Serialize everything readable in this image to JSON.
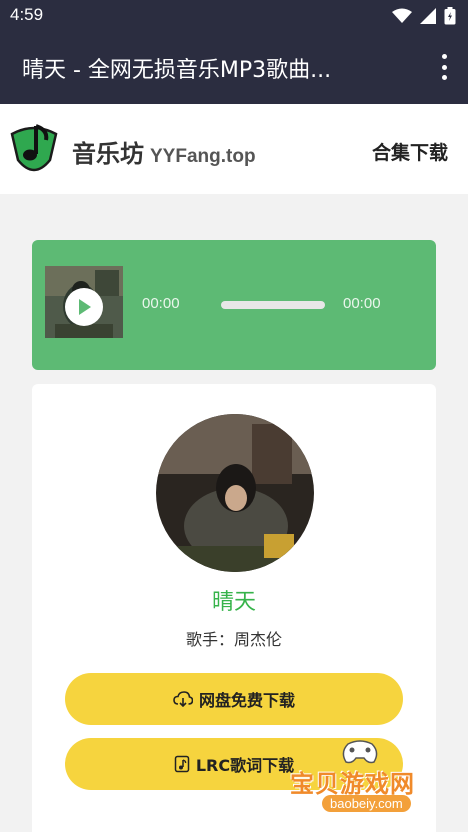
{
  "status_bar": {
    "time": "4:59"
  },
  "app_bar": {
    "title": "晴天 - 全网无损音乐MP3歌曲..."
  },
  "site_header": {
    "brand_name": "音乐坊",
    "brand_domain": "YYFang.top",
    "collection_download": "合集下载"
  },
  "player": {
    "current_time": "00:00",
    "duration": "00:00",
    "progress": 0
  },
  "song": {
    "title": "晴天",
    "artist_line": "歌手：周杰伦"
  },
  "buttons": {
    "netdisk_download": "网盘免费下载",
    "lrc_download": "LRC歌词下载"
  },
  "watermark": {
    "text": "宝贝游戏网",
    "url": "baobeiy.com"
  },
  "colors": {
    "bar_bg": "#2b2d40",
    "player_green": "#5dba74",
    "title_green": "#36b34a",
    "button_yellow": "#f6d43e"
  }
}
